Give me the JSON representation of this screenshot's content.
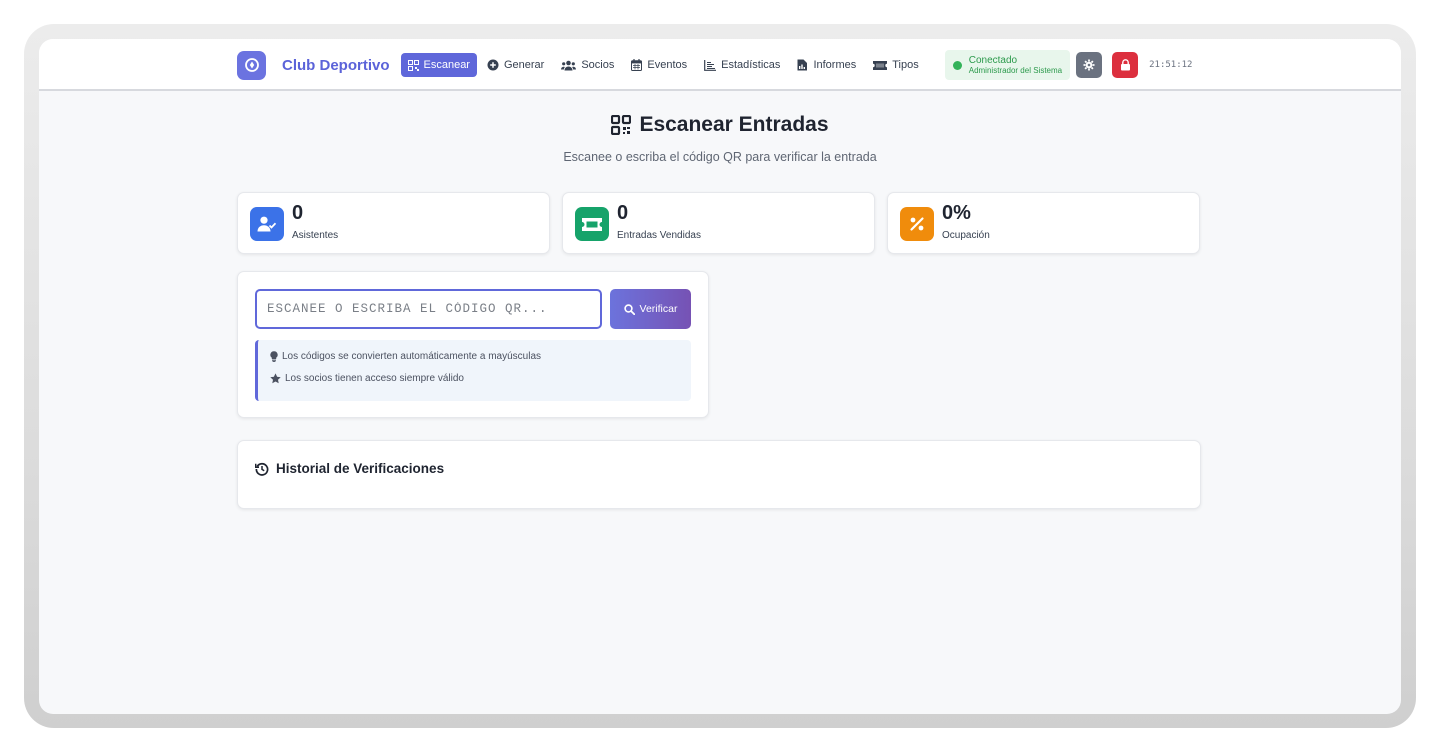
{
  "nav": {
    "brand": "Club Deportivo",
    "items": [
      {
        "label": "Escanear",
        "icon": "qrcode-icon",
        "active": true
      },
      {
        "label": "Generar",
        "icon": "plus-circle-icon"
      },
      {
        "label": "Socios",
        "icon": "users-icon"
      },
      {
        "label": "Eventos",
        "icon": "calendar-icon"
      },
      {
        "label": "Estadísticas",
        "icon": "chart-line-icon"
      },
      {
        "label": "Informes",
        "icon": "file-chart-icon"
      },
      {
        "label": "Tipos",
        "icon": "ticket-icon"
      }
    ],
    "status": {
      "title": "Conectado",
      "subtitle": "Administrador del Sistema",
      "color": "#34b35a"
    },
    "clock": "21:51:12"
  },
  "header": {
    "title": "Escanear Entradas",
    "subtitle": "Escanee o escriba el código QR para verificar la entrada"
  },
  "stats": [
    {
      "value": "0",
      "label": "Asistentes",
      "icon": "user-check-icon",
      "color": "#3b72e8"
    },
    {
      "value": "0",
      "label": "Entradas Vendidas",
      "icon": "ticket-icon",
      "color": "#16a36a"
    },
    {
      "value": "0%",
      "label": "Ocupación",
      "icon": "percent-icon",
      "color": "#f08c0c"
    }
  ],
  "scanner": {
    "placeholder": "ESCANEE O ESCRIBA EL CÓDIGO QR...",
    "value": "",
    "button_label": "Verificar",
    "tips": [
      {
        "icon": "lightbulb-icon",
        "text": "Los códigos se convierten automáticamente a mayúsculas"
      },
      {
        "icon": "star-icon",
        "text": "Los socios tienen acceso siempre válido"
      }
    ]
  },
  "history": {
    "title": "Historial de Verificaciones"
  },
  "colors": {
    "accent": "#5f67da",
    "danger": "#dc2f3e"
  }
}
